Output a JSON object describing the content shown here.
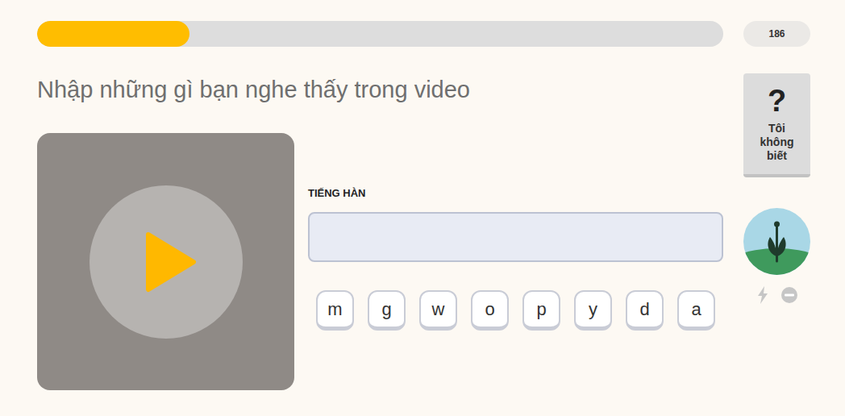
{
  "progress": {
    "level": 0.222
  },
  "score": "186",
  "prompt": "Nhập những gì bạn nghe thấy trong video",
  "video": {
    "playing": false
  },
  "answer": {
    "label": "TIẾNG HÀN",
    "value": ""
  },
  "keys": [
    "m",
    "g",
    "w",
    "o",
    "p",
    "y",
    "d",
    "a"
  ],
  "skip_button": {
    "icon": "?",
    "label": "Tôi không biết"
  }
}
